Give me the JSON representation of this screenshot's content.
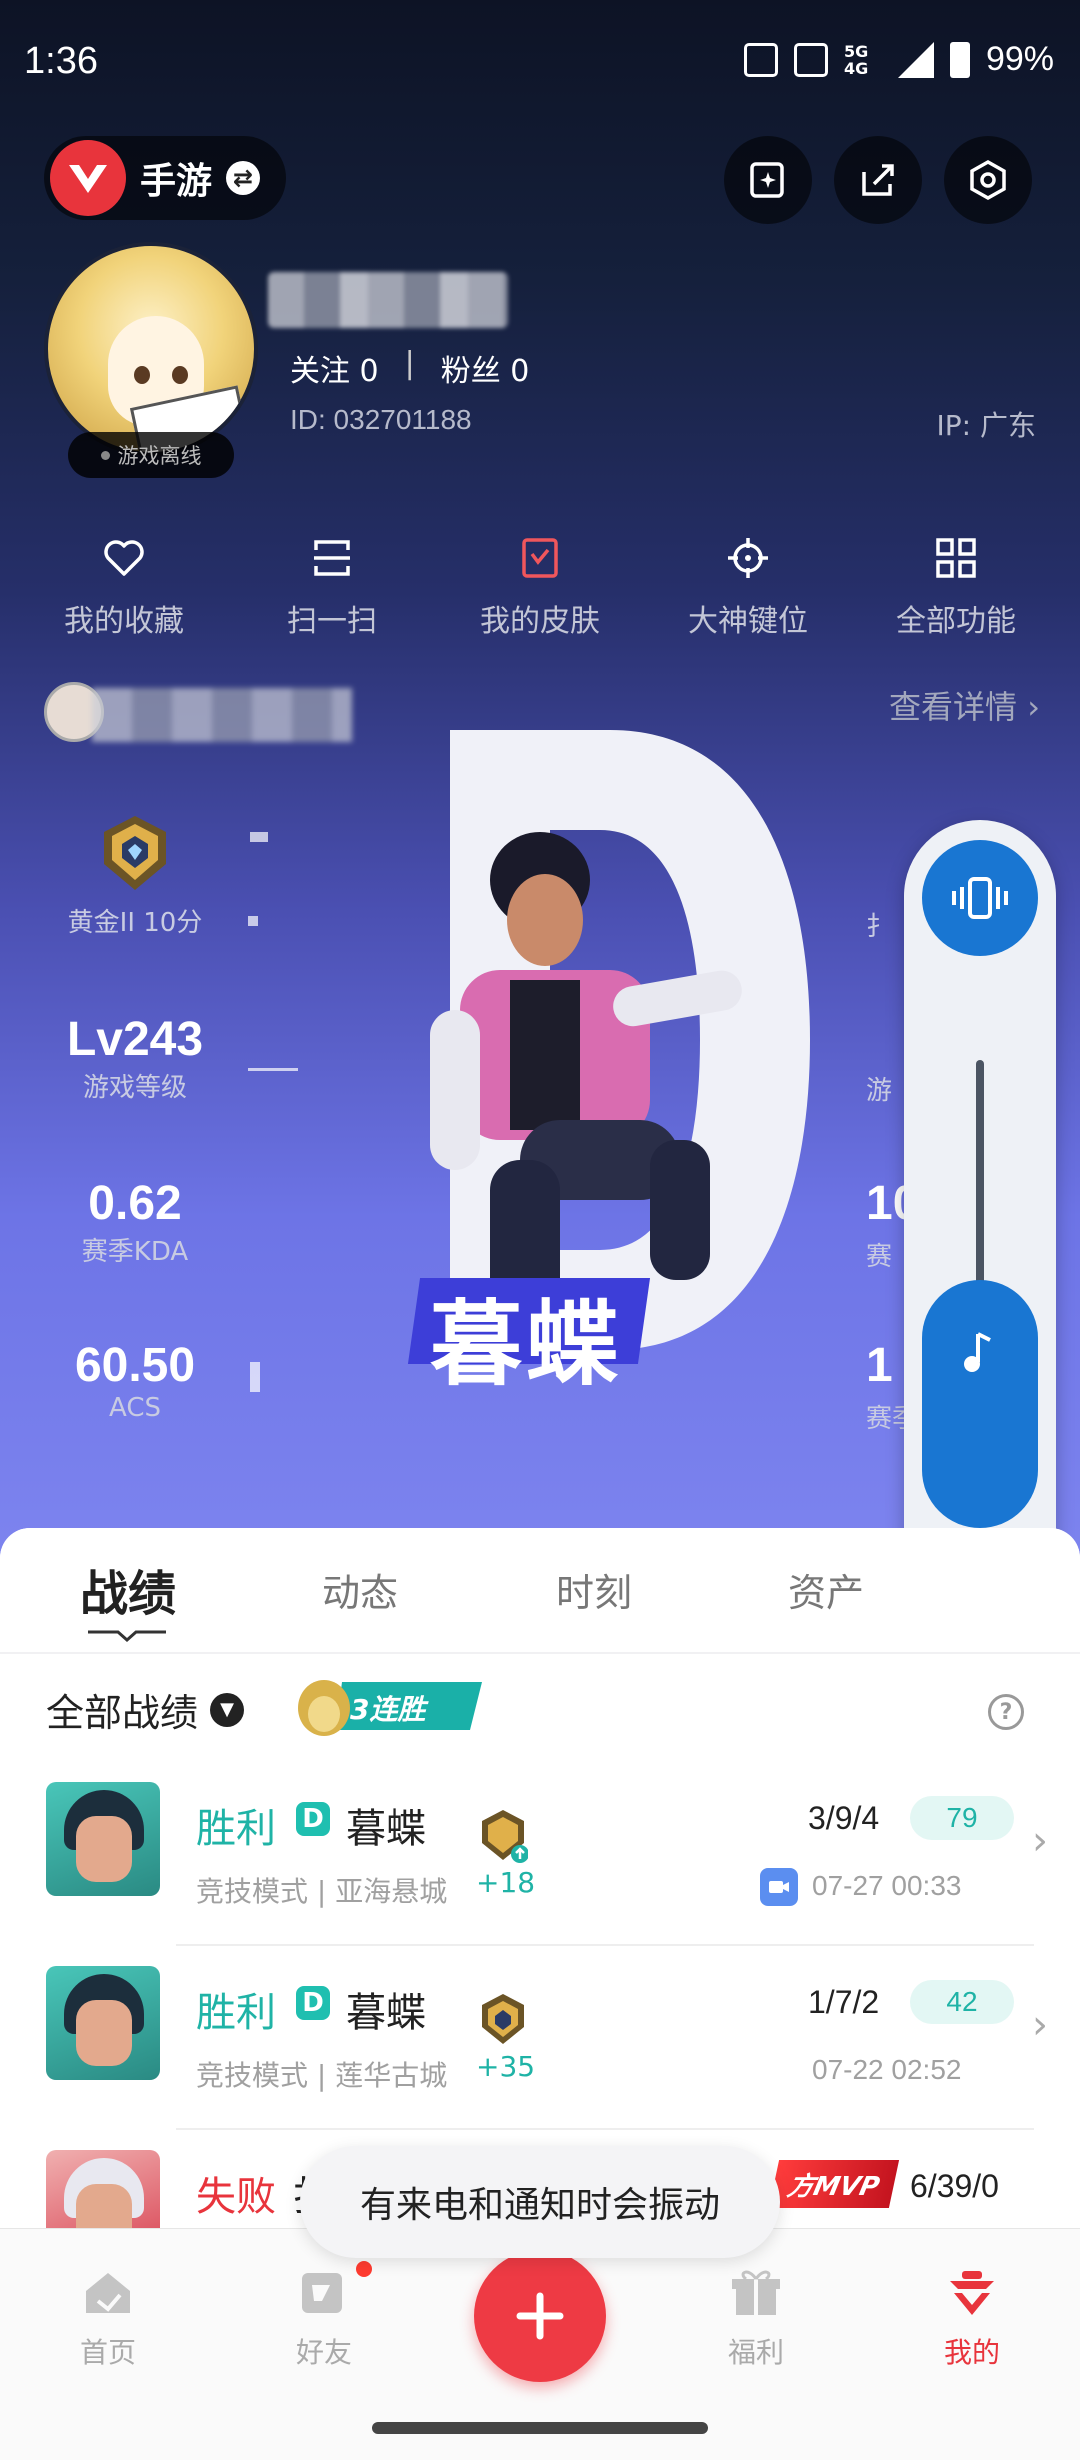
{
  "status_bar": {
    "time": "1:36",
    "network": "5G 4G",
    "battery": "99%"
  },
  "header": {
    "game_name": "手游"
  },
  "profile": {
    "status": "游戏离线",
    "follow_label": "关注 0",
    "separator": "|",
    "fans_label": "粉丝 0",
    "id_text": "ID:  032701188",
    "ip_text": "IP:  广东"
  },
  "quick_functions": [
    {
      "label": "我的收藏",
      "icon": "heart-icon"
    },
    {
      "label": "扫一扫",
      "icon": "scan-icon"
    },
    {
      "label": "我的皮肤",
      "icon": "skin-icon"
    },
    {
      "label": "大神键位",
      "icon": "crosshair-icon"
    },
    {
      "label": "全部功能",
      "icon": "grid-icon"
    }
  ],
  "account": {
    "detail_link": "查看详情 ›"
  },
  "stats": {
    "rank": "黄金II 10分",
    "level_value": "Lv243",
    "level_label": "游戏等级",
    "kda_value": "0.62",
    "kda_label": "赛季KDA",
    "acs_value": "60.50",
    "acs_label": "ACS",
    "right_top": "扌",
    "right_level": "游",
    "right_kda": "10",
    "right_kda_label": "赛",
    "right_acs": "1",
    "right_acs_label": "赛季"
  },
  "hero": {
    "letter": "D",
    "name": "暮蝶"
  },
  "volume_panel": {
    "more": "•••"
  },
  "tabs": [
    "战绩",
    "动态",
    "时刻",
    "资产"
  ],
  "filter": {
    "label": "全部战绩",
    "streak": "3连胜",
    "help": "?"
  },
  "matches": [
    {
      "result": "胜利",
      "result_color": "#1fb3a6",
      "badge": "D",
      "hero": "暮蝶",
      "mode": "竞技模式 | 亚海悬城",
      "delta": "+18",
      "kda": "3/9/4",
      "score": "79",
      "time": "07-27 00:33",
      "has_video": true,
      "mvp": ""
    },
    {
      "result": "胜利",
      "result_color": "#1fb3a6",
      "badge": "D",
      "hero": "暮蝶",
      "mode": "竞技模式 | 莲华古城",
      "delta": "+35",
      "kda": "1/7/2",
      "score": "42",
      "time": "07-22 02:52",
      "has_video": false,
      "mvp": ""
    },
    {
      "result": "失败",
      "result_color": "#e8343c",
      "badge": "",
      "hero": "扌",
      "mode": "",
      "delta": "",
      "kda": "6/39/0",
      "score": "",
      "time": "",
      "has_video": false,
      "mvp": "方MVP"
    }
  ],
  "toast": {
    "text": "有来电和通知时会振动"
  },
  "bottom_nav": [
    {
      "label": "首页",
      "icon": "home-icon"
    },
    {
      "label": "好友",
      "icon": "friends-icon"
    },
    {
      "label": "福利",
      "icon": "gift-icon"
    },
    {
      "label": "我的",
      "icon": "profile-icon"
    }
  ],
  "colors": {
    "accent_red": "#e8343c",
    "accent_teal": "#1fb3a6",
    "volume_blue": "#1976d2"
  }
}
